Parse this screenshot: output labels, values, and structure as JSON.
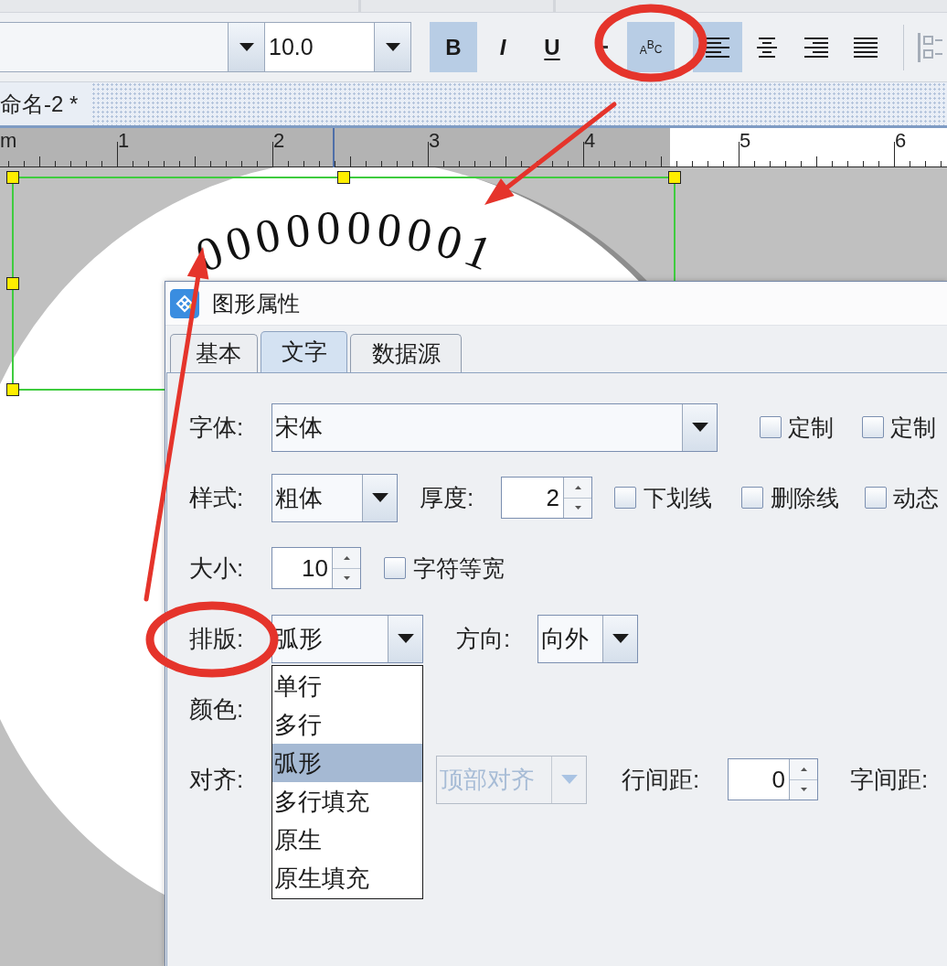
{
  "toolbar": {
    "font_size": {
      "value": "10.0"
    },
    "format_buttons": [
      {
        "kind": "bold",
        "label": "B",
        "selected": true
      },
      {
        "kind": "italic",
        "label": "I",
        "selected": false
      },
      {
        "kind": "underline",
        "label": "U",
        "selected": false
      },
      {
        "kind": "strikethrough",
        "selected": false
      },
      {
        "kind": "arc_text",
        "label": "ABC",
        "selected": true
      }
    ],
    "align_buttons": [
      {
        "kind": "left",
        "selected": true
      },
      {
        "kind": "center",
        "selected": false
      },
      {
        "kind": "right",
        "selected": false
      },
      {
        "kind": "justify",
        "selected": false
      }
    ]
  },
  "document_tab": {
    "label": "命名-2 *"
  },
  "ruler": {
    "unit": "m",
    "labels": [
      "1",
      "2",
      "3",
      "4",
      "5",
      "6"
    ]
  },
  "canvas": {
    "arc_text": "0000000001"
  },
  "dialog": {
    "title": "图形属性",
    "tabs": [
      {
        "label": "基本",
        "selected": false
      },
      {
        "label": "文字",
        "selected": true
      },
      {
        "label": "数据源",
        "selected": false
      }
    ],
    "font": {
      "label": "字体:",
      "value": "宋体"
    },
    "custom_options": [
      {
        "label": "定制",
        "checked": false
      },
      {
        "label": "定制",
        "checked": false
      }
    ],
    "style": {
      "label": "样式:",
      "value": "粗体"
    },
    "thickness": {
      "label": "厚度:",
      "value": "2"
    },
    "decorations": [
      {
        "label": "下划线",
        "checked": false
      },
      {
        "label": "删除线",
        "checked": false
      },
      {
        "label": "动态",
        "checked": false
      }
    ],
    "size": {
      "label": "大小:",
      "value": "10"
    },
    "monospace": {
      "label": "字符等宽",
      "checked": false
    },
    "layout": {
      "label": "排版:",
      "value": "弧形",
      "expanded": true,
      "options": [
        {
          "label": "单行",
          "selected": false
        },
        {
          "label": "多行",
          "selected": false
        },
        {
          "label": "弧形",
          "selected": true
        },
        {
          "label": "多行填充",
          "selected": false
        },
        {
          "label": "原生",
          "selected": false
        },
        {
          "label": "原生填充",
          "selected": false
        }
      ]
    },
    "direction": {
      "label": "方向:",
      "value": "向外"
    },
    "color": {
      "label": "颜色:"
    },
    "align": {
      "label": "对齐:",
      "vertical": {
        "value": "顶部对齐",
        "disabled": true
      }
    },
    "line_spacing": {
      "label": "行间距:",
      "value": "0"
    },
    "char_spacing": {
      "label": "字间距:"
    }
  }
}
